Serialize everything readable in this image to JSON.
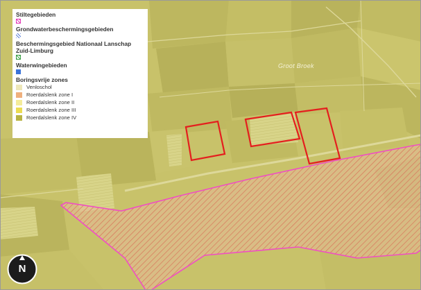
{
  "legend": {
    "stiltegebieden": {
      "title": "Stiltegebieden",
      "color": "#e23fb8"
    },
    "grondwater": {
      "title": "Grondwaterbeschermingsgebieden",
      "color": "#5b7fd6"
    },
    "nationaal_landschap": {
      "title": "Beschermingsgebied Nationaal Lanschap Zuid-Limburg",
      "color": "#3fa24a"
    },
    "waterwingebieden": {
      "title": "Waterwingebieden",
      "color": "#3b73d9"
    },
    "boringsvrije": {
      "title": "Boringsvrije zones",
      "items": [
        {
          "label": "Venloschol",
          "color": "#ede7b8"
        },
        {
          "label": "Roerdalslenk zone I",
          "color": "#efb07d"
        },
        {
          "label": "Roerdalslenk zone II",
          "color": "#f4ec9b"
        },
        {
          "label": "Roerdalslenk zone III",
          "color": "#ecdc52"
        },
        {
          "label": "Roerdalslenk zone IV",
          "color": "#b8b343"
        }
      ]
    }
  },
  "map": {
    "place_label": "Groot Broek",
    "overlay_color": "#cfc95c",
    "zone_boundary_color": "#f04dc4",
    "hatch_color": "#e58a6c",
    "plot_outline_color": "#e41e1e"
  },
  "north_arrow": {
    "label": "N"
  }
}
